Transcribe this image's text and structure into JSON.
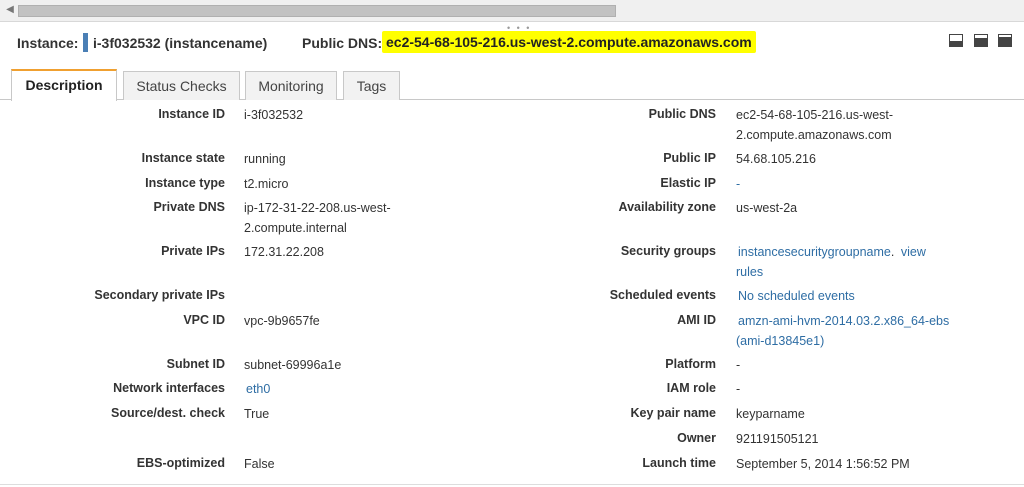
{
  "header": {
    "instance_label": "Instance:",
    "instance_value": "i-3f032532 (instancename)",
    "public_dns_label": "Public DNS:",
    "public_dns_value": "ec2-54-68-105-216.us-west-2.compute.amazonaws.com",
    "highlight_color": "#ffff00",
    "marker_color": "#4a7fb5"
  },
  "layout_icons": [
    "panel-bottom-small-icon",
    "panel-bottom-medium-icon",
    "panel-bottom-large-icon"
  ],
  "tabs": [
    {
      "label": "Description",
      "active": true
    },
    {
      "label": "Status Checks",
      "active": false
    },
    {
      "label": "Monitoring",
      "active": false
    },
    {
      "label": "Tags",
      "active": false
    }
  ],
  "left_fields": {
    "instance_id": {
      "key": "Instance ID",
      "value": "i-3f032532"
    },
    "instance_state": {
      "key": "Instance state",
      "value": "running"
    },
    "instance_type": {
      "key": "Instance type",
      "value": "t2.micro"
    },
    "private_dns": {
      "key": "Private DNS",
      "value_line1": "ip-172-31-22-208.us-west-",
      "value_line2": "2.compute.internal"
    },
    "private_ips": {
      "key": "Private IPs",
      "value": "172.31.22.208"
    },
    "secondary_private_ips": {
      "key": "Secondary private IPs",
      "value": ""
    },
    "vpc_id": {
      "key": "VPC ID",
      "value": "vpc-9b9657fe"
    },
    "subnet_id": {
      "key": "Subnet ID",
      "value": "subnet-69996a1e"
    },
    "network_interfaces": {
      "key": "Network interfaces",
      "value": "eth0"
    },
    "source_dest_check": {
      "key": "Source/dest. check",
      "value": "True"
    },
    "ebs_optimized": {
      "key": "EBS-optimized",
      "value": "False"
    }
  },
  "right_fields": {
    "public_dns": {
      "key": "Public DNS",
      "value_line1": "ec2-54-68-105-216.us-west-",
      "value_line2": "2.compute.amazonaws.com"
    },
    "public_ip": {
      "key": "Public IP",
      "value": "54.68.105.216"
    },
    "elastic_ip": {
      "key": "Elastic IP",
      "value": "-"
    },
    "availability_zone": {
      "key": "Availability zone",
      "value": "us-west-2a"
    },
    "security_groups": {
      "key": "Security groups",
      "group": "instancesecuritygroupname",
      "sep": ".",
      "view": "view",
      "rules": "rules"
    },
    "scheduled_events": {
      "key": "Scheduled events",
      "value": "No scheduled events"
    },
    "ami_id": {
      "key": "AMI ID",
      "value_line1": "amzn-ami-hvm-2014.03.2.x86_64-ebs",
      "value_line2": "(ami-d13845e1)"
    },
    "platform": {
      "key": "Platform",
      "value": "-"
    },
    "iam_role": {
      "key": "IAM role",
      "value": "-"
    },
    "key_pair_name": {
      "key": "Key pair name",
      "value": "keyparname"
    },
    "owner": {
      "key": "Owner",
      "value": "921191505121"
    },
    "launch_time": {
      "key": "Launch time",
      "value": "September 5, 2014 1:56:52 PM"
    }
  }
}
